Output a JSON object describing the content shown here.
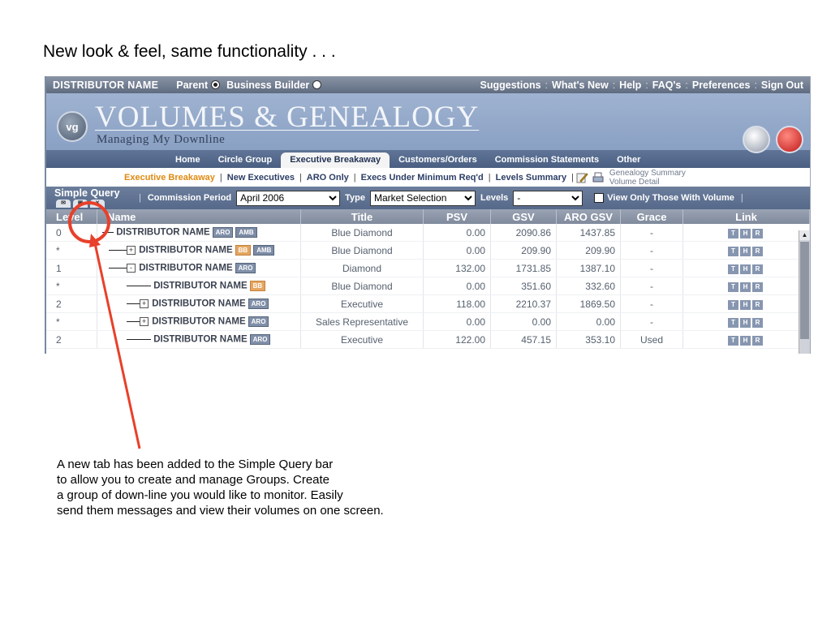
{
  "slide_title": "New look & feel, same functionality . . .",
  "topbar": {
    "distributor": "DISTRIBUTOR NAME",
    "parent_label": "Parent",
    "bb_label": "Business Builder",
    "links": [
      "Suggestions",
      "What's New",
      "Help",
      "FAQ's",
      "Preferences",
      "Sign Out"
    ]
  },
  "banner": {
    "logo": "vg",
    "title": "VOLUMES & GENEALOGY",
    "subtitle": "Managing My Downline"
  },
  "nav_tabs": [
    "Home",
    "Circle Group",
    "Executive Breakaway",
    "Customers/Orders",
    "Commission Statements",
    "Other"
  ],
  "subnav": {
    "items": [
      "Executive Breakaway",
      "New Executives",
      "ARO Only",
      "Execs Under Minimum Req'd",
      "Levels Summary"
    ],
    "detail_1": "Genealogy Summary",
    "detail_2": "Volume Detail"
  },
  "query": {
    "title": "Simple Query",
    "period_label": "Commission Period",
    "period_value": "April 2006",
    "type_label": "Type",
    "type_value": "Market Selection",
    "levels_label": "Levels",
    "levels_value": "-",
    "view_only_label": "View Only Those With Volume"
  },
  "columns": [
    "Level",
    "Name",
    "Title",
    "PSV",
    "GSV",
    "ARO GSV",
    "Grace",
    "Link"
  ],
  "rows": [
    {
      "level": "0",
      "name": "DISTRIBUTOR NAME",
      "title": "Blue Diamond",
      "psv": "0.00",
      "gsv": "2090.86",
      "aro_gsv": "1437.85",
      "grace": "-"
    },
    {
      "level": "*",
      "name": "DISTRIBUTOR NAME",
      "title": "Blue Diamond",
      "psv": "0.00",
      "gsv": "209.90",
      "aro_gsv": "209.90",
      "grace": "-"
    },
    {
      "level": "1",
      "name": "DISTRIBUTOR NAME",
      "title": "Diamond",
      "psv": "132.00",
      "gsv": "1731.85",
      "aro_gsv": "1387.10",
      "grace": "-"
    },
    {
      "level": "*",
      "name": "DISTRIBUTOR NAME",
      "title": "Blue Diamond",
      "psv": "0.00",
      "gsv": "351.60",
      "aro_gsv": "332.60",
      "grace": "-"
    },
    {
      "level": "2",
      "name": "DISTRIBUTOR NAME",
      "title": "Executive",
      "psv": "118.00",
      "gsv": "2210.37",
      "aro_gsv": "1869.50",
      "grace": "-"
    },
    {
      "level": "*",
      "name": "DISTRIBUTOR NAME",
      "title": "Sales Representative",
      "psv": "0.00",
      "gsv": "0.00",
      "aro_gsv": "0.00",
      "grace": "-"
    },
    {
      "level": "2",
      "name": "DISTRIBUTOR NAME",
      "title": "Executive",
      "psv": "122.00",
      "gsv": "457.15",
      "aro_gsv": "353.10",
      "grace": "Used"
    }
  ],
  "badges": {
    "aro": "ARO",
    "amb": "AMB",
    "bb": "BB"
  },
  "link_buttons": [
    "T",
    "H",
    "R"
  ],
  "annotation": [
    "A new tab has been added to the Simple Query bar",
    "to allow you to create and manage Groups.  Create",
    "a group of down-line you would like to monitor.  Easily",
    "send them messages and view their volumes on one screen."
  ],
  "colors": {
    "accent": "#e8402a",
    "active_subnav": "#e08a12"
  }
}
